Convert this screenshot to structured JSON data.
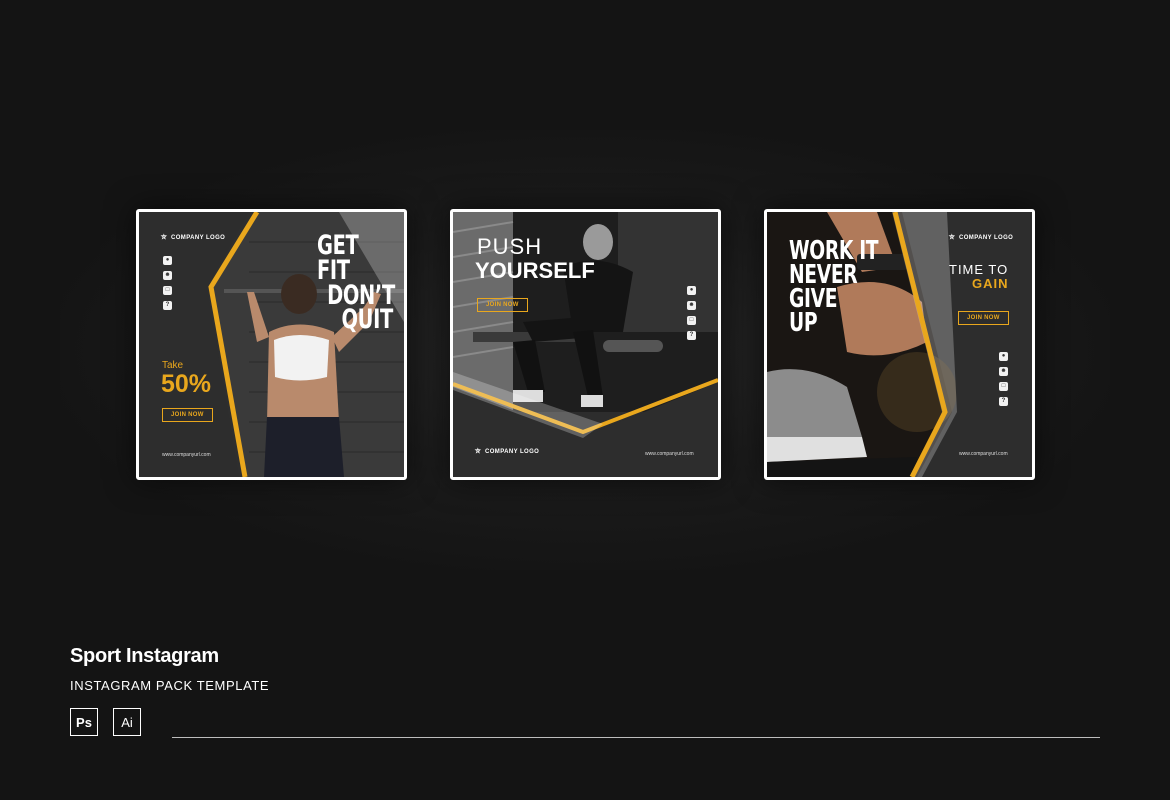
{
  "cards": [
    {
      "logo": "COMPANY LOGO",
      "headline": [
        "GET FIT",
        "DON’T",
        "QUIT"
      ],
      "promo_prefix": "Take",
      "promo_value": "50%",
      "button": "JOIN NOW",
      "url": "www.companyurl.com"
    },
    {
      "headline_light": "PUSH",
      "headline_bold": "YOURSELF",
      "button": "JOIN NOW",
      "logo": "COMPANY LOGO",
      "url": "www.companyurl.com"
    },
    {
      "logo": "COMPANY LOGO",
      "headline": [
        "WORK IT",
        "NEVER",
        "GIVE",
        "UP"
      ],
      "tagline_1": "TIME TO",
      "tagline_2": "GAIN",
      "button": "JOIN NOW",
      "url": "www.companyurl.com"
    }
  ],
  "social_icons": [
    "globe-icon",
    "user-icon",
    "instagram-icon",
    "help-icon"
  ],
  "footer": {
    "title": "Sport Instagram",
    "subtitle": "INSTAGRAM PACK TEMPLATE",
    "badges": [
      "Ps",
      "Ai"
    ]
  },
  "colors": {
    "background": "#141414",
    "accent": "#e9a71d",
    "panel": "#2d2d2d"
  }
}
